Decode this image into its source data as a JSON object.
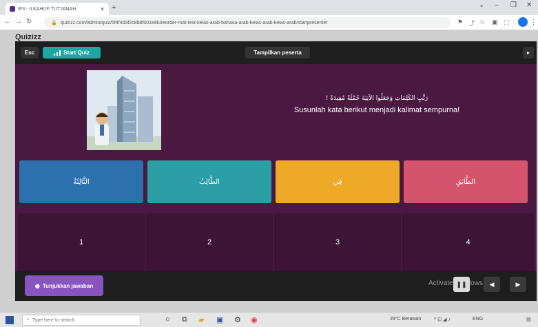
{
  "browser": {
    "tab_title": "IF3 - ILKAHUF TUTJANAH",
    "url": "quizizz.com/admin/quiz/5f4f4d3f2c8b8f001e8b/reorder-mat-test-kelas-arab-bahasa-arab-kelas-arab-kelas-arab/startpresenter"
  },
  "brand": "Quizizz",
  "topbar": {
    "esc_label": "Esc",
    "start_label": "Start Quiz",
    "peserta_label": "Tampilkan peserta"
  },
  "question": {
    "arabic": "رَتِّبِ الكَلِمَاتِ وَجَعَلُوا الآتِيَةَ جُمْلَةً مُفِيدَةً !",
    "indonesian": "Susunlah kata berikut menjadi kalimat sempurna!"
  },
  "options": [
    {
      "label": "الثَّالِثَةُ",
      "color": "#2d70ae"
    },
    {
      "label": "الطَّالِبُ",
      "color": "#2d9da6"
    },
    {
      "label": "فِي",
      "color": "#efa929"
    },
    {
      "label": "الطَّابَقِ",
      "color": "#d5546d"
    }
  ],
  "slots": [
    "1",
    "2",
    "3",
    "4"
  ],
  "bottom": {
    "answer_label": "Tunjukkan jawaban",
    "activate_text": "Activate Windows"
  },
  "taskbar": {
    "search_placeholder": "Type here to search",
    "weather": "29°C Berawan",
    "lang": "ENG"
  },
  "colors": {
    "stage_bg": "#4a1942",
    "bar_bg": "#1e1e1e",
    "start_btn": "#1ea7a0",
    "answer_btn": "#8854c0"
  }
}
